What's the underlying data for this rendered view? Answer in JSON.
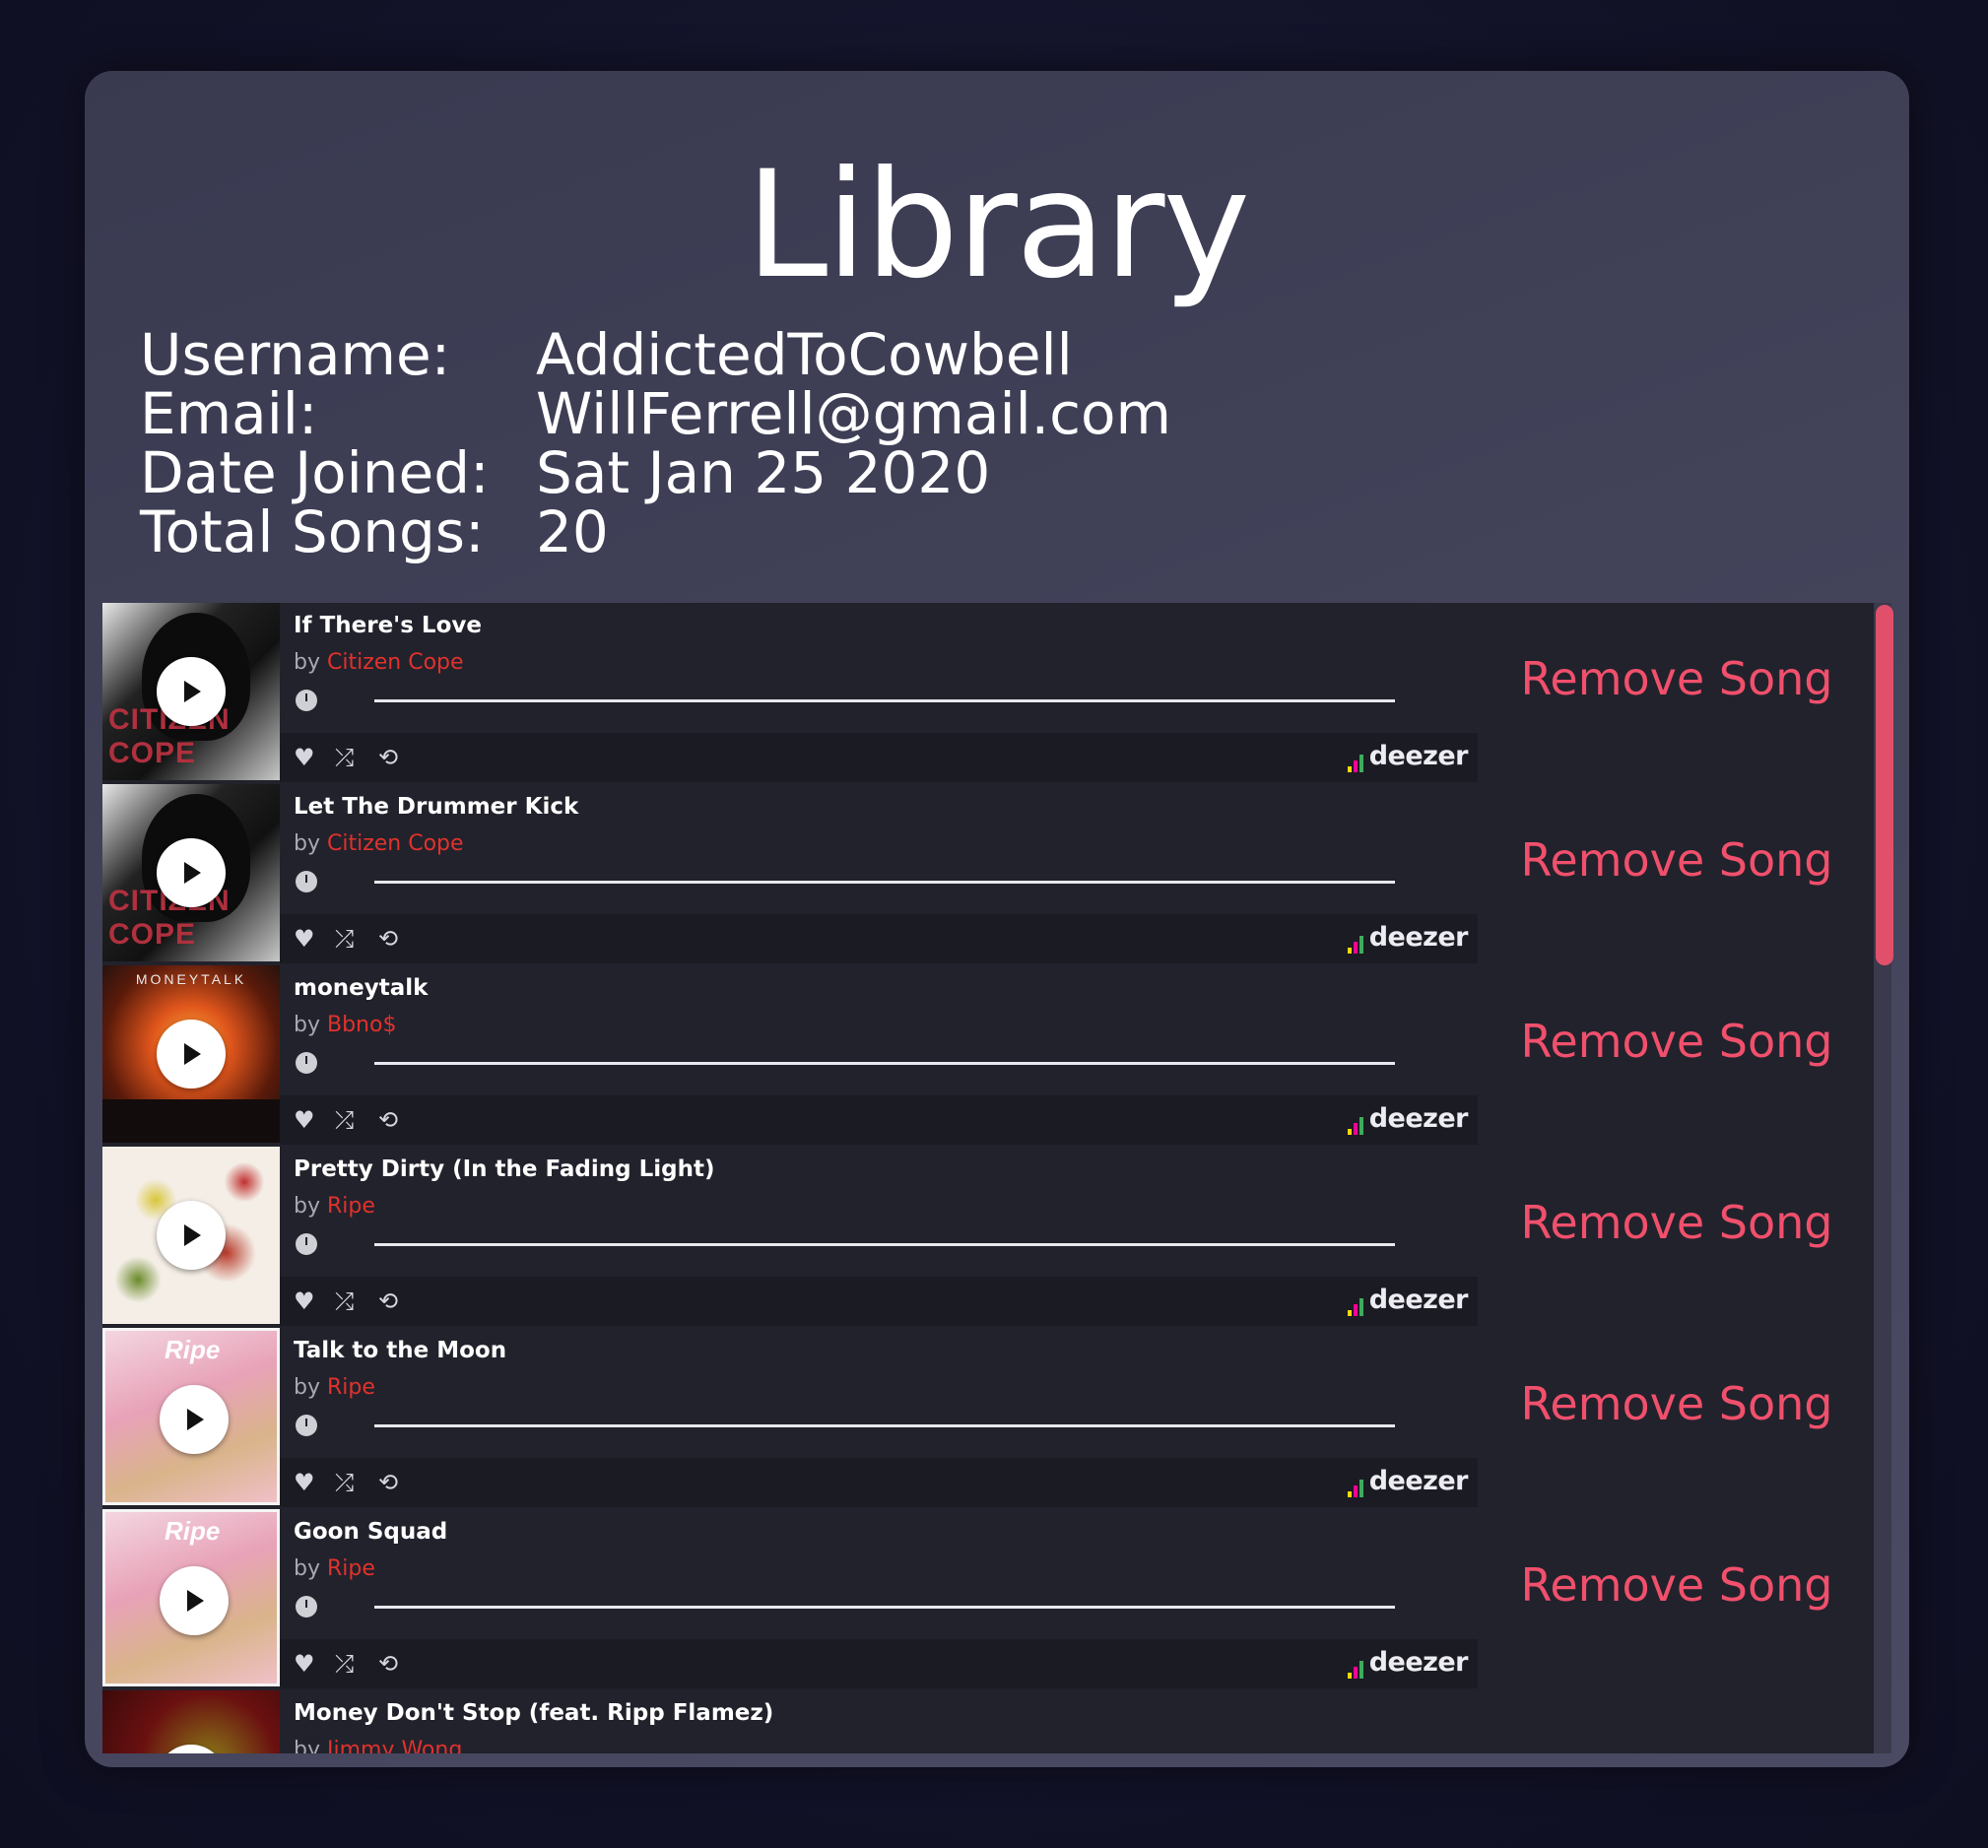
{
  "page": {
    "title": "Library"
  },
  "profile": {
    "rows": [
      {
        "label": "Username:",
        "value": "AddictedToCowbell"
      },
      {
        "label": "Email:",
        "value": "WillFerrell@gmail.com"
      },
      {
        "label": "Date Joined:",
        "value": "Sat Jan 25 2020"
      },
      {
        "label": "Total Songs:",
        "value": "20"
      }
    ]
  },
  "songs": [
    {
      "title": "If There's Love",
      "by": "by",
      "artist": "Citizen Cope",
      "remove_label": "Remove Song",
      "provider": "deezer"
    },
    {
      "title": "Let The Drummer Kick",
      "by": "by",
      "artist": "Citizen Cope",
      "remove_label": "Remove Song",
      "provider": "deezer"
    },
    {
      "title": "moneytalk",
      "by": "by",
      "artist": "Bbno$",
      "remove_label": "Remove Song",
      "provider": "deezer"
    },
    {
      "title": "Pretty Dirty (In the Fading Light)",
      "by": "by",
      "artist": "Ripe",
      "remove_label": "Remove Song",
      "provider": "deezer"
    },
    {
      "title": "Talk to the Moon",
      "by": "by",
      "artist": "Ripe",
      "remove_label": "Remove Song",
      "provider": "deezer"
    },
    {
      "title": "Goon Squad",
      "by": "by",
      "artist": "Ripe",
      "remove_label": "Remove Song",
      "provider": "deezer"
    },
    {
      "title": "Money Don't Stop (feat. Ripp Flamez)",
      "by": "by",
      "artist": "Jimmy Wong",
      "remove_label": "",
      "provider": ""
    }
  ],
  "colors": {
    "accent": "#f0506c",
    "artist": "#e0322c",
    "panel": "#43435a",
    "list_bg": "#22222c"
  },
  "icons": {
    "play": "play-icon",
    "clock": "clock-icon",
    "heart": "heart-icon",
    "shuffle": "shuffle-icon",
    "repeat": "repeat-icon"
  }
}
